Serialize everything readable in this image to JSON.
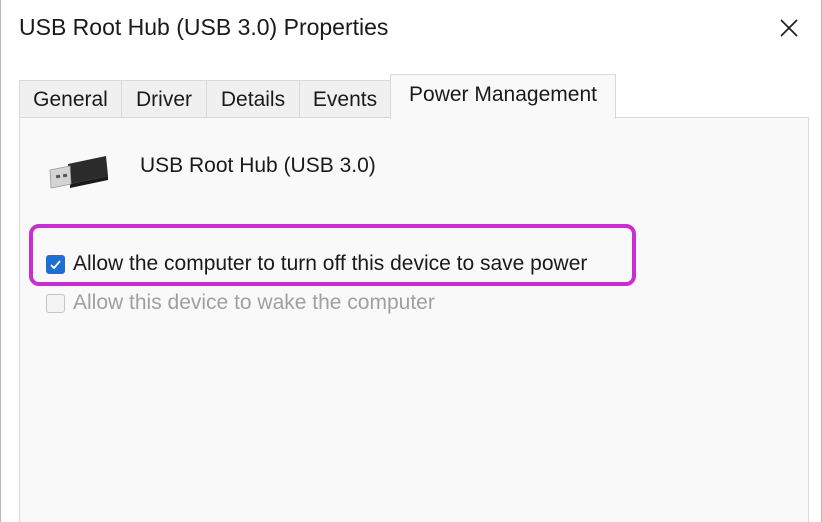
{
  "window": {
    "title": "USB Root Hub (USB 3.0) Properties",
    "close_icon": "close-icon"
  },
  "tabs": [
    {
      "label": "General",
      "active": false
    },
    {
      "label": "Driver",
      "active": false
    },
    {
      "label": "Details",
      "active": false
    },
    {
      "label": "Events",
      "active": false
    },
    {
      "label": "Power Management",
      "active": true
    }
  ],
  "panel": {
    "device_icon": "usb-connector-icon",
    "device_name": "USB Root Hub (USB 3.0)",
    "options": [
      {
        "label": "Allow the computer to turn off this device to save power",
        "checked": true,
        "enabled": true
      },
      {
        "label": "Allow this device to wake the computer",
        "checked": false,
        "enabled": false
      }
    ]
  },
  "colors": {
    "accent": "#1f6fd1",
    "highlight": "#c92ed0",
    "panel_bg": "#f9f9f9",
    "disabled_text": "#a0a0a0"
  }
}
